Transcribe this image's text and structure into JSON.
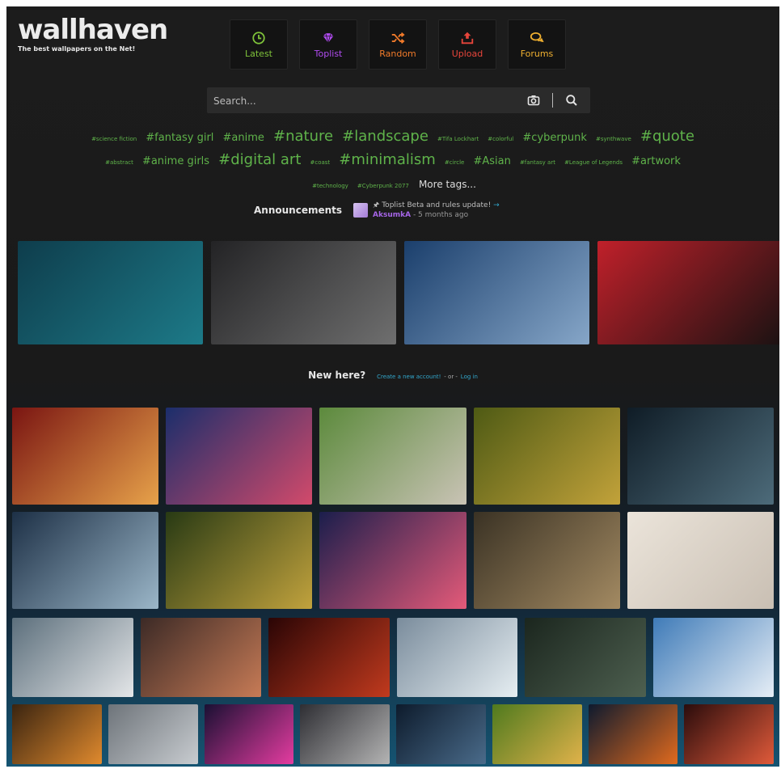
{
  "brand": {
    "name": "wallhaven",
    "tagline": "The best wallpapers on the Net!"
  },
  "nav": [
    {
      "label": "Latest",
      "icon": "clock-icon",
      "color": "#7fc33a"
    },
    {
      "label": "Toplist",
      "icon": "diamond-icon",
      "color": "#b04bf0"
    },
    {
      "label": "Random",
      "icon": "shuffle-icon",
      "color": "#f07a2a"
    },
    {
      "label": "Upload",
      "icon": "upload-icon",
      "color": "#e8453b"
    },
    {
      "label": "Forums",
      "icon": "chat-icon",
      "color": "#f0b030"
    }
  ],
  "search": {
    "placeholder": "Search..."
  },
  "tags": [
    {
      "text": "#science fiction",
      "size": "s1"
    },
    {
      "text": "#fantasy girl",
      "size": "s2"
    },
    {
      "text": "#anime",
      "size": "s2"
    },
    {
      "text": "#nature",
      "size": "s3"
    },
    {
      "text": "#landscape",
      "size": "s3"
    },
    {
      "text": "#Tifa Lockhart",
      "size": "s1"
    },
    {
      "text": "#colorful",
      "size": "s1"
    },
    {
      "text": "#cyberpunk",
      "size": "s2"
    },
    {
      "text": "#synthwave",
      "size": "s1"
    },
    {
      "text": "#quote",
      "size": "s3"
    },
    {
      "text": "#abstract",
      "size": "s1"
    },
    {
      "text": "#anime girls",
      "size": "s2"
    },
    {
      "text": "#digital art",
      "size": "s3"
    },
    {
      "text": "#coast",
      "size": "s1"
    },
    {
      "text": "#minimalism",
      "size": "s3"
    },
    {
      "text": "#circle",
      "size": "s1"
    },
    {
      "text": "#Asian",
      "size": "s2"
    },
    {
      "text": "#fantasy art",
      "size": "s1"
    },
    {
      "text": "#League of Legends",
      "size": "s1"
    },
    {
      "text": "#artwork",
      "size": "s2"
    },
    {
      "text": "#technology",
      "size": "s1"
    },
    {
      "text": "#Cyberpunk 2077",
      "size": "s1"
    }
  ],
  "more_tags": "More tags...",
  "announcements": {
    "title": "Announcements",
    "link": "Toplist Beta and rules update!",
    "user": "AksumkA",
    "time": "- 5 months ago"
  },
  "new_here": {
    "question": "New here?",
    "create": "Create a new account!",
    "or": "- or -",
    "login": "Log in"
  },
  "featured": [
    {
      "c": [
        "#0e3d4c",
        "#1d7a88"
      ]
    },
    {
      "c": [
        "#232325",
        "#6f6f6f"
      ]
    },
    {
      "c": [
        "#1b3f6c",
        "#86a6c8"
      ]
    },
    {
      "c": [
        "#c0202a",
        "#1a1212"
      ]
    }
  ],
  "grid": [
    {
      "c": [
        "#7a1512",
        "#e7a24a"
      ]
    },
    {
      "c": [
        "#1b2e6b",
        "#d24a6b"
      ]
    },
    {
      "c": [
        "#5c8a3c",
        "#c9c3b5"
      ]
    },
    {
      "c": [
        "#4e5a14",
        "#c2a23a"
      ]
    },
    {
      "c": [
        "#0f1c26",
        "#4d6b7a"
      ]
    },
    {
      "c": [
        "#1d3046",
        "#9bb6c8"
      ]
    },
    {
      "c": [
        "#283a14",
        "#c1a23d"
      ]
    },
    {
      "c": [
        "#1b1e4c",
        "#e45a79"
      ]
    },
    {
      "c": [
        "#3a3224",
        "#a38a62"
      ]
    },
    {
      "c": [
        "#ebe4da",
        "#c9bfb3"
      ]
    },
    {
      "c": [
        "#5c6f7c",
        "#e4e6e8"
      ]
    },
    {
      "c": [
        "#3c2a26",
        "#c77b56"
      ]
    },
    {
      "c": [
        "#2a0505",
        "#c13a1e"
      ]
    },
    {
      "c": [
        "#7a8c9c",
        "#e6eef2"
      ]
    },
    {
      "c": [
        "#1b261e",
        "#4e6050"
      ]
    },
    {
      "c": [
        "#3f7bb8",
        "#e6eef6"
      ]
    },
    {
      "c": [
        "#3a2410",
        "#e08a2e"
      ]
    },
    {
      "c": [
        "#6e747a",
        "#c8ccd0"
      ]
    },
    {
      "c": [
        "#1a1033",
        "#e43ca0"
      ]
    },
    {
      "c": [
        "#2e2e33",
        "#b4b4b4"
      ]
    },
    {
      "c": [
        "#0d1b2c",
        "#4a6b8a"
      ]
    },
    {
      "c": [
        "#4f7a1e",
        "#e0b24a"
      ]
    },
    {
      "c": [
        "#0e1a2e",
        "#e06a1e"
      ]
    },
    {
      "c": [
        "#2a0c0c",
        "#e05a3a"
      ]
    }
  ]
}
